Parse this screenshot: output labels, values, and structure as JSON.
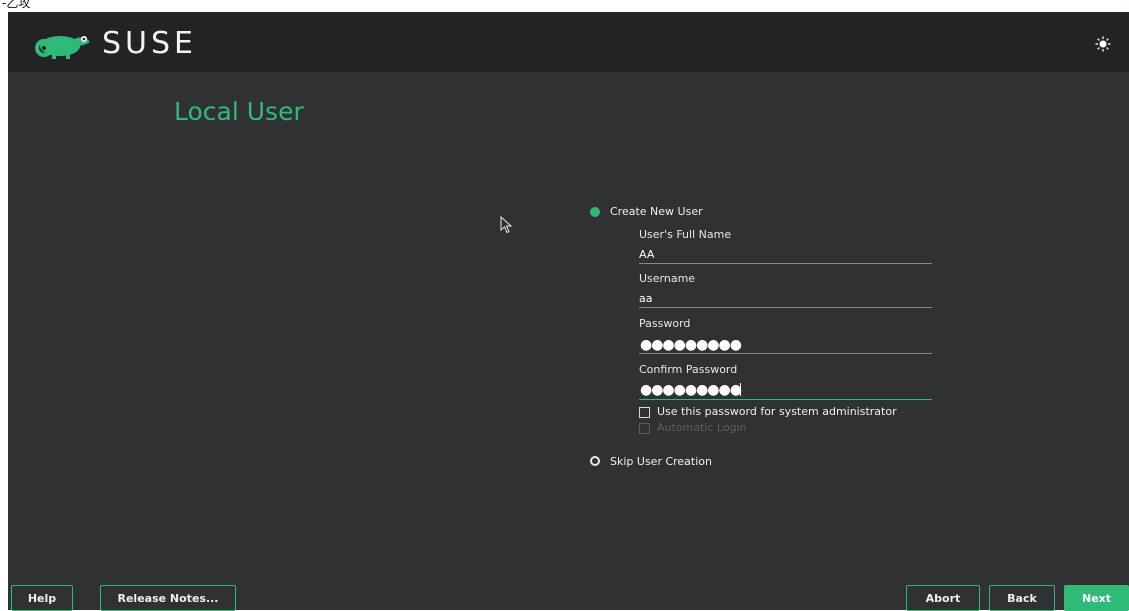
{
  "top_strip": {
    "text": "-乙攻"
  },
  "header": {
    "brand": "SUSE",
    "logo_icon": "chameleon-logo-icon",
    "theme_icon": "brightness-icon"
  },
  "page": {
    "title": "Local User"
  },
  "options": {
    "create_user": {
      "label": "Create New User",
      "selected": true
    },
    "skip_user": {
      "label": "Skip User Creation",
      "selected": false
    }
  },
  "form": {
    "full_name": {
      "label": "User's Full Name",
      "value": "AA"
    },
    "username": {
      "label": "Username",
      "value": "aa"
    },
    "password": {
      "label": "Password",
      "value": "●●●●●●●●●"
    },
    "confirm_password": {
      "label": "Confirm Password",
      "value": "●●●●●●●●●"
    },
    "use_for_admin": {
      "label": "Use this password for system administrator",
      "checked": false
    },
    "auto_login": {
      "label": "Automatic Login",
      "checked": false,
      "enabled": false
    }
  },
  "buttons": {
    "help": "Help",
    "release_notes": "Release Notes...",
    "abort": "Abort",
    "back": "Back",
    "next": "Next"
  },
  "colors": {
    "accent": "#30ba78",
    "background": "#2f3132",
    "header": "#222324"
  }
}
